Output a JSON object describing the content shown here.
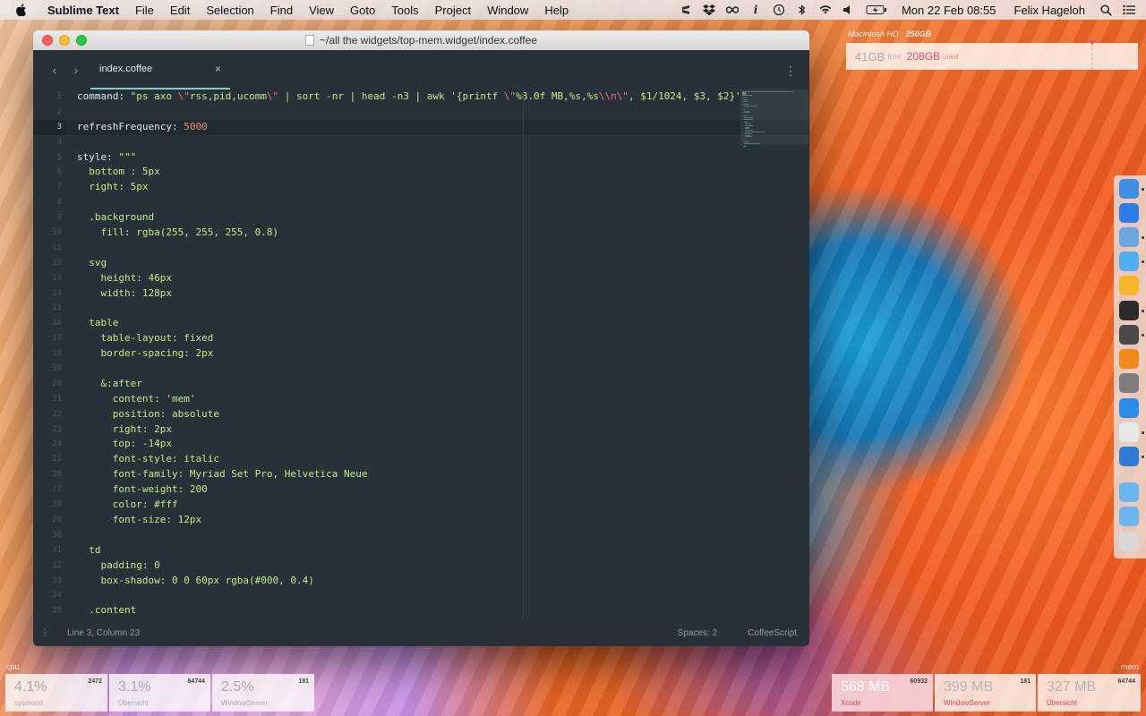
{
  "menubar": {
    "app_name": "Sublime Text",
    "menus": [
      "File",
      "Edit",
      "Selection",
      "Find",
      "View",
      "Goto",
      "Tools",
      "Project",
      "Window",
      "Help"
    ],
    "clock": "Mon 22 Feb  08:55",
    "user": "Felix Hageloh",
    "tray_icons": [
      "sublime-tray-icon",
      "dropbox-icon",
      "infinity-icon",
      "info-icon",
      "time-machine-icon",
      "bluetooth-icon",
      "wifi-icon",
      "volume-icon",
      "battery-icon",
      "search-icon",
      "notification-center-icon"
    ]
  },
  "window": {
    "title": "~/all the widgets/top-mem.widget/index.coffee",
    "tab": {
      "label": "index.coffee",
      "close": "×"
    },
    "nav_back": "‹",
    "nav_forward": "›",
    "tab_menu": "⋮"
  },
  "editor": {
    "active_line": 3,
    "lines": [
      [
        [
          "c-key",
          "command: "
        ],
        [
          "c-str",
          "\"ps axo "
        ],
        [
          "c-esc",
          "\\\""
        ],
        [
          "c-str",
          "rss,pid,ucomm"
        ],
        [
          "c-esc",
          "\\\""
        ],
        [
          "c-str",
          " | sort -nr | head -n3 | awk '{printf "
        ],
        [
          "c-esc",
          "\\\""
        ],
        [
          "c-str",
          "%8.0f MB,%s,%s"
        ],
        [
          "c-esc",
          "\\\\n\\\""
        ],
        [
          "c-str",
          ", $1/1024, $3, $2}'\""
        ]
      ],
      [],
      [
        [
          "c-key",
          "refreshFrequency: "
        ],
        [
          "c-num",
          "5000"
        ]
      ],
      [],
      [
        [
          "c-key",
          "style: "
        ],
        [
          "c-str",
          "\"\"\""
        ]
      ],
      [
        [
          "c-str",
          "  bottom : 5px"
        ]
      ],
      [
        [
          "c-str",
          "  right: 5px"
        ]
      ],
      [],
      [
        [
          "c-str",
          "  .background"
        ]
      ],
      [
        [
          "c-str",
          "    fill: rgba(255, 255, 255, 0.8)"
        ]
      ],
      [],
      [
        [
          "c-str",
          "  svg"
        ]
      ],
      [
        [
          "c-str",
          "    height: 46px"
        ]
      ],
      [
        [
          "c-str",
          "    width: 128px"
        ]
      ],
      [],
      [
        [
          "c-str",
          "  table"
        ]
      ],
      [
        [
          "c-str",
          "    table-layout: fixed"
        ]
      ],
      [
        [
          "c-str",
          "    border-spacing: 2px"
        ]
      ],
      [],
      [
        [
          "c-str",
          "    &:after"
        ]
      ],
      [
        [
          "c-str",
          "      content: 'mem'"
        ]
      ],
      [
        [
          "c-str",
          "      position: absolute"
        ]
      ],
      [
        [
          "c-str",
          "      right: 2px"
        ]
      ],
      [
        [
          "c-str",
          "      top: -14px"
        ]
      ],
      [
        [
          "c-str",
          "      font-style: italic"
        ]
      ],
      [
        [
          "c-str",
          "      font-family: Myriad Set Pro, Helvetica Neue"
        ]
      ],
      [
        [
          "c-str",
          "      font-weight: 200"
        ]
      ],
      [
        [
          "c-str",
          "      color: #fff"
        ]
      ],
      [
        [
          "c-str",
          "      font-size: 12px"
        ]
      ],
      [],
      [
        [
          "c-str",
          "  td"
        ]
      ],
      [
        [
          "c-str",
          "    padding: 0"
        ]
      ],
      [
        [
          "c-str",
          "    box-shadow: 0 0 60px rgba(#000, 0.4)"
        ]
      ],
      [],
      [
        [
          "c-str",
          "  .content"
        ]
      ]
    ]
  },
  "statusbar": {
    "menu": "⋮",
    "position": "Line 3, Column 23",
    "spaces": "Spaces: 2",
    "syntax": "CoffeeScript"
  },
  "disk_widget": {
    "label": "Macintosh HD",
    "size": "250GB",
    "free_value": "41GB",
    "free_label": "free",
    "used_value": "208GB",
    "used_label": "used",
    "used_fraction": 0.832
  },
  "dock": {
    "icons": [
      {
        "name": "finder-icon",
        "color": "#3d8fe0",
        "dot": true
      },
      {
        "name": "safari-icon",
        "color": "#2b7ee6",
        "dot": false
      },
      {
        "name": "preview-icon",
        "color": "#6aa6e0",
        "dot": true
      },
      {
        "name": "messages-icon",
        "color": "#4fb0f0",
        "dot": true
      },
      {
        "name": "sketch-icon",
        "color": "#f7b52a",
        "dot": false
      },
      {
        "name": "terminal-icon",
        "color": "#2b2b2b",
        "dot": true
      },
      {
        "name": "sublime-text-icon",
        "color": "#4a4a4a",
        "dot": true
      },
      {
        "name": "pages-icon",
        "color": "#f08a1c",
        "dot": false
      },
      {
        "name": "system-preferences-icon",
        "color": "#7d7d7d",
        "dot": false
      },
      {
        "name": "app-store-icon",
        "color": "#2a8de8",
        "dot": false
      },
      {
        "name": "slack-icon",
        "color": "#e8e8e8",
        "dot": true
      },
      {
        "name": "xcode-icon",
        "color": "#2f7bd6",
        "dot": true
      },
      {
        "name": "applications-folder-icon",
        "color": "#6bb6f0",
        "dot": false
      },
      {
        "name": "downloads-folder-icon",
        "color": "#6bb6f0",
        "dot": false
      },
      {
        "name": "trash-icon",
        "color": "#d8d8d8",
        "dot": false
      }
    ]
  },
  "cpu_widget": {
    "label": "cpu",
    "items": [
      {
        "value": "4.1%",
        "pid": "2472",
        "name": "sysmond"
      },
      {
        "value": "3.1%",
        "pid": "64744",
        "name": "Übersicht"
      },
      {
        "value": "2.5%",
        "pid": "181",
        "name": "WindowServer"
      }
    ]
  },
  "mem_widget": {
    "label": "mem",
    "items": [
      {
        "value": "568 MB",
        "pid": "60932",
        "name": "Xcode"
      },
      {
        "value": "399 MB",
        "pid": "181",
        "name": "WindowServer"
      },
      {
        "value": "327 MB",
        "pid": "64744",
        "name": "Übersicht"
      }
    ]
  }
}
